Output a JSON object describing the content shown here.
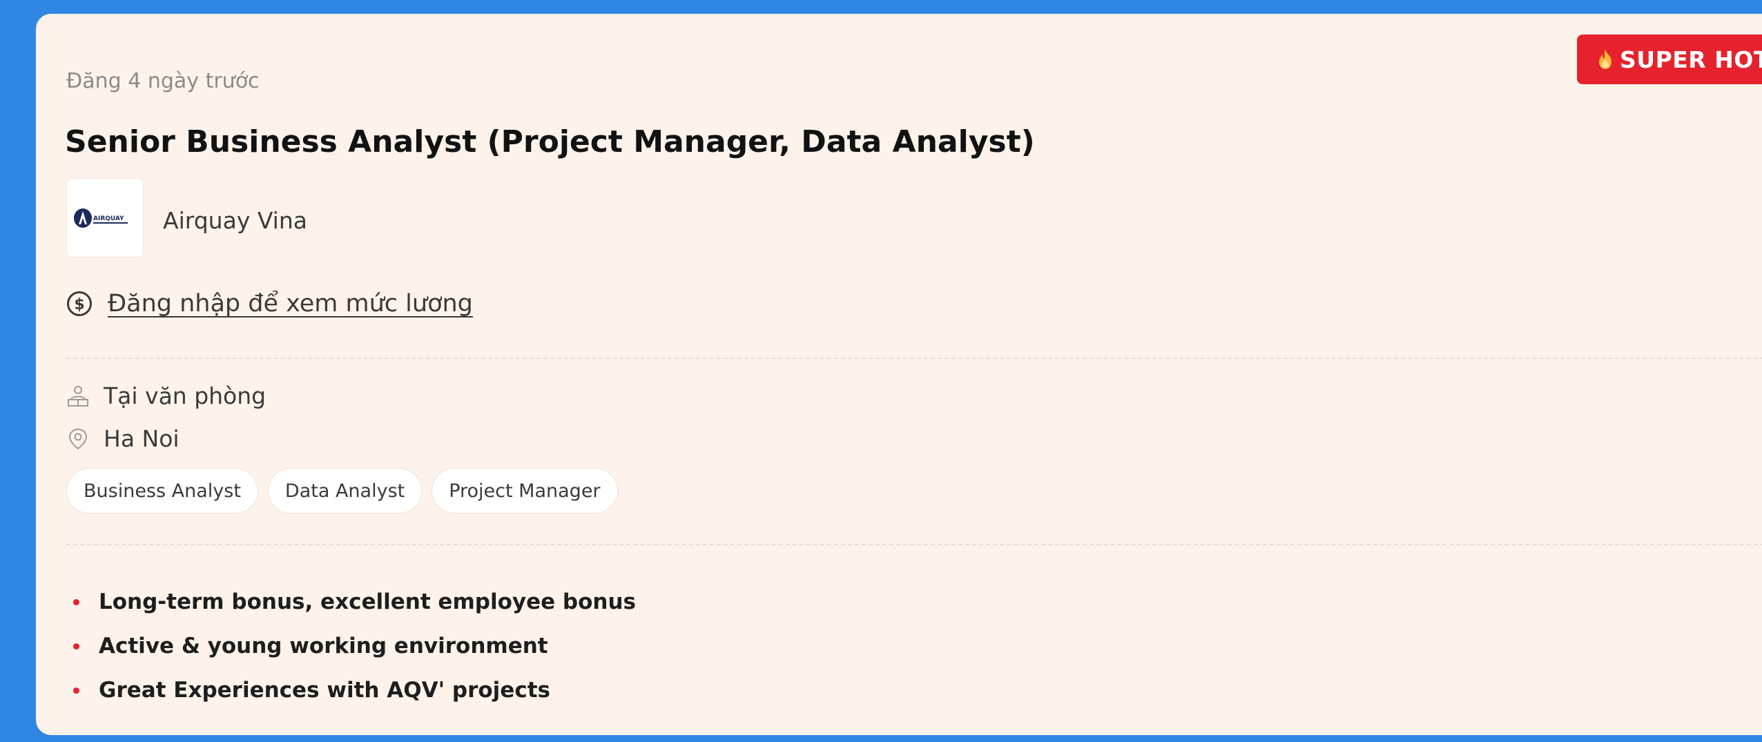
{
  "job": {
    "posted": "Đăng 4 ngày trước",
    "badge": "SUPER HOT",
    "title": "Senior Business Analyst (Project Manager, Data Analyst)",
    "company": "Airquay Vina",
    "logo_text": "AIRQUAY",
    "salary_link": "Đăng nhập để xem mức lương",
    "work_mode": "Tại văn phòng",
    "location": "Ha Noi",
    "tags": [
      "Business Analyst",
      "Data Analyst",
      "Project Manager"
    ],
    "benefits": [
      "Long-term bonus, excellent employee bonus",
      "Active & young working environment",
      "Great Experiences with AQV' projects"
    ]
  },
  "colors": {
    "page_background": "#2f86e3",
    "card_background": "#fef3ea",
    "badge_red": "#e5222d",
    "bullet_red": "#e5222d"
  },
  "icons": {
    "badge": "flame-icon",
    "salary": "dollar-circle-icon",
    "work_mode": "office-worker-icon",
    "location": "map-pin-icon"
  }
}
